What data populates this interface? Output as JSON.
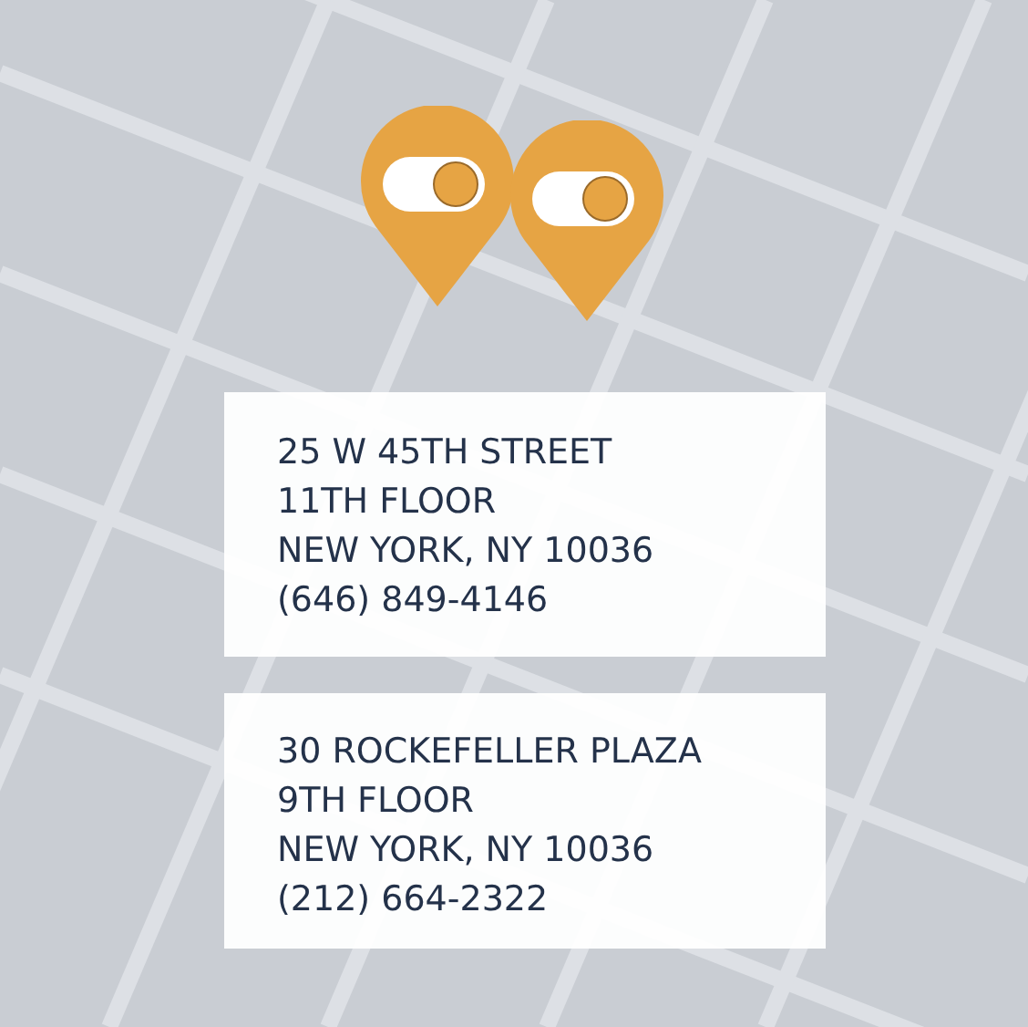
{
  "locations": [
    {
      "lines": [
        "25 W 45TH STREET",
        "11TH FLOOR",
        "NEW YORK, NY 10036",
        "(646) 849-4146"
      ]
    },
    {
      "lines": [
        "30 ROCKEFELLER PLAZA",
        "9TH FLOOR",
        "NEW YORK, NY 10036",
        "(212) 664-2322"
      ]
    }
  ]
}
